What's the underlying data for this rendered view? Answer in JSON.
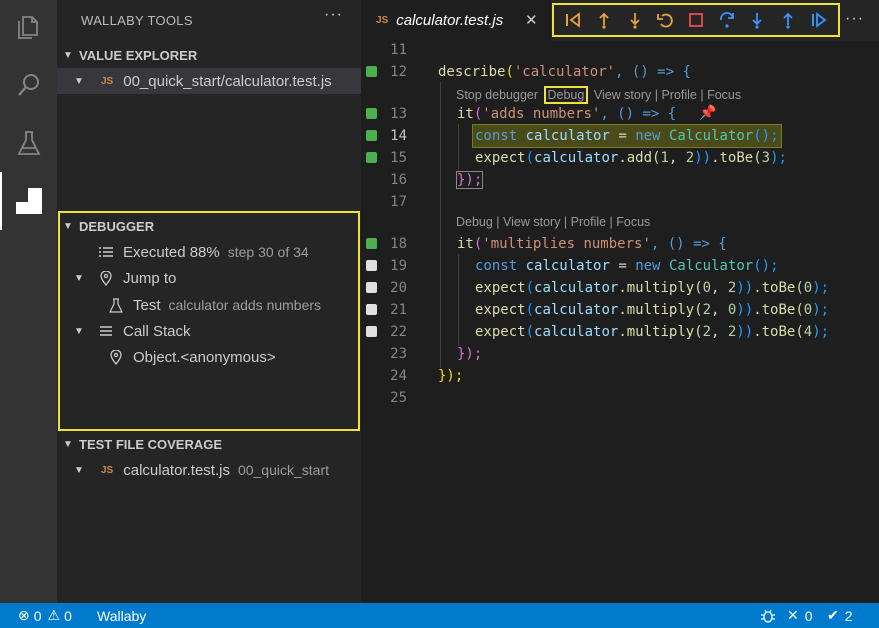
{
  "sidebar": {
    "title": "WALLABY TOOLS",
    "more": "···",
    "value_explorer": {
      "title": "VALUE EXPLORER",
      "file_badge": "JS",
      "file_label": "00_quick_start/calculator.test.js"
    },
    "debugger": {
      "title": "DEBUGGER",
      "executed_label": "Executed 88%",
      "executed_desc": "step 30 of 34",
      "jump_to_label": "Jump to",
      "test_label": "Test",
      "test_desc": "calculator adds numbers",
      "call_stack_label": "Call Stack",
      "frame_label": "Object.<anonymous>"
    },
    "coverage": {
      "title": "TEST FILE COVERAGE",
      "file_badge": "JS",
      "file_label": "calculator.test.js",
      "file_desc": "00_quick_start"
    }
  },
  "editor": {
    "tab": {
      "badge": "JS",
      "title": "calculator.test.js",
      "close": "✕"
    },
    "more": "···",
    "debug_toolbar": [
      "step-back",
      "step-out-back",
      "step-into",
      "restart",
      "stop",
      "step-over",
      "step-into-down",
      "step-out",
      "continue"
    ],
    "lens_1": {
      "stop": "Stop debugger",
      "debug": "Debug",
      "rest": "View story | Profile | Focus"
    },
    "lens_2": "Debug | View story | Profile | Focus",
    "line_numbers": [
      "11",
      "12",
      "13",
      "14",
      "15",
      "16",
      "17",
      "18",
      "19",
      "20",
      "21",
      "22",
      "23",
      "24",
      "25"
    ],
    "code": {
      "l12": {
        "a": "describe",
        "b": "(",
        "c": "'calculator'",
        "d": ", () => {"
      },
      "l13": {
        "a": "it",
        "b": "(",
        "c": "'adds numbers'",
        "d": ", () => {"
      },
      "l14": {
        "a": "const",
        "b": "calculator",
        "c": "=",
        "d": "new",
        "e": "Calculator",
        "f": "();"
      },
      "l15": {
        "a": "expect",
        "b": "(",
        "c": "calculator",
        "d": ".add(",
        "e": "1",
        "f": ", ",
        "g": "2",
        "h": "))",
        "i": ".toBe(",
        "j": "3",
        "k": ");"
      },
      "l16": {
        "a": "});"
      },
      "l18": {
        "a": "it",
        "b": "(",
        "c": "'multiplies numbers'",
        "d": ", () => {"
      },
      "l19": {
        "a": "const",
        "b": "calculator",
        "c": "=",
        "d": "new",
        "e": "Calculator",
        "f": "();"
      },
      "l20": {
        "a": "expect",
        "b": "(",
        "c": "calculator",
        "d": ".multiply(",
        "e": "0",
        "f": ", ",
        "g": "2",
        "h": "))",
        "i": ".toBe(",
        "j": "0",
        "k": ");"
      },
      "l21": {
        "a": "expect",
        "b": "(",
        "c": "calculator",
        "d": ".multiply(",
        "e": "2",
        "f": ", ",
        "g": "0",
        "h": "))",
        "i": ".toBe(",
        "j": "0",
        "k": ");"
      },
      "l22": {
        "a": "expect",
        "b": "(",
        "c": "calculator",
        "d": ".multiply(",
        "e": "2",
        "f": ", ",
        "g": "2",
        "h": "))",
        "i": ".toBe(",
        "j": "4",
        "k": ");"
      },
      "l23": {
        "a": "});"
      },
      "l24": {
        "a": "});"
      }
    }
  },
  "statusbar": {
    "errors": "0",
    "warnings": "0",
    "wallaby": "Wallaby",
    "failed": "0",
    "passed": "2"
  },
  "colors": {
    "accent": "#007acc",
    "highlight": "#f0e23a",
    "covered": "#4caf50",
    "uncovered": "#e0e0e0"
  }
}
